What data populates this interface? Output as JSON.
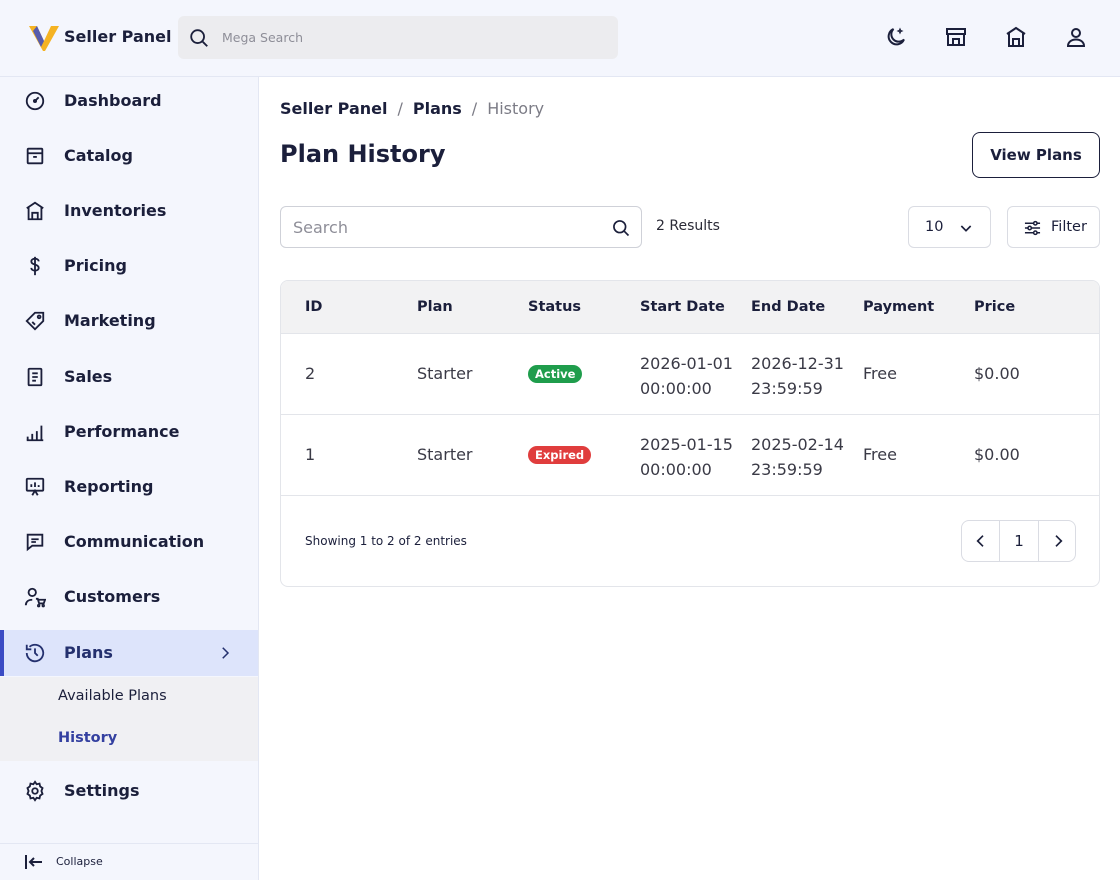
{
  "header": {
    "brand": "Seller Panel",
    "search_placeholder": "Mega Search",
    "icons": [
      "moon-icon",
      "store-icon",
      "warehouse-icon",
      "user-icon"
    ]
  },
  "sidebar": {
    "items": [
      {
        "label": "Dashboard",
        "icon": "gauge-icon"
      },
      {
        "label": "Catalog",
        "icon": "box-icon"
      },
      {
        "label": "Inventories",
        "icon": "warehouse-icon"
      },
      {
        "label": "Pricing",
        "icon": "dollar-icon"
      },
      {
        "label": "Marketing",
        "icon": "tag-icon"
      },
      {
        "label": "Sales",
        "icon": "receipt-icon"
      },
      {
        "label": "Performance",
        "icon": "bar-chart-icon"
      },
      {
        "label": "Reporting",
        "icon": "presentation-icon"
      },
      {
        "label": "Communication",
        "icon": "message-icon"
      },
      {
        "label": "Customers",
        "icon": "user-cart-icon"
      },
      {
        "label": "Plans",
        "icon": "history-icon"
      },
      {
        "label": "Settings",
        "icon": "gear-icon"
      }
    ],
    "submenu": [
      {
        "label": "Available Plans"
      },
      {
        "label": "History"
      }
    ],
    "collapse_label": "Collapse"
  },
  "main": {
    "breadcrumbs": [
      "Seller Panel",
      "Plans",
      "History"
    ],
    "title": "Plan History",
    "view_plans_label": "View Plans",
    "search_placeholder": "Search",
    "results_text": "2 Results",
    "per_page": "10",
    "filter_label": "Filter",
    "table": {
      "columns": [
        "ID",
        "Plan",
        "Status",
        "Start Date",
        "End Date",
        "Payment",
        "Price"
      ],
      "rows": [
        {
          "id": "2",
          "plan": "Starter",
          "status": "Active",
          "start_date": "2026-01-01",
          "start_time": "00:00:00",
          "end_date": "2026-12-31",
          "end_time": "23:59:59",
          "payment": "Free",
          "price": "$0.00"
        },
        {
          "id": "1",
          "plan": "Starter",
          "status": "Expired",
          "start_date": "2025-01-15",
          "start_time": "00:00:00",
          "end_date": "2025-02-14",
          "end_time": "23:59:59",
          "payment": "Free",
          "price": "$0.00"
        }
      ]
    },
    "showing_text": "Showing 1 to 2 of 2 entries",
    "current_page": "1"
  },
  "colors": {
    "accent": "#3a4bc4",
    "sidebar_bg": "#f4f6fd",
    "active_badge": "#1f9d4c",
    "expired_badge": "#e03d3d",
    "logo_yellow": "#f5b323",
    "logo_blue": "#3a4bc4"
  }
}
